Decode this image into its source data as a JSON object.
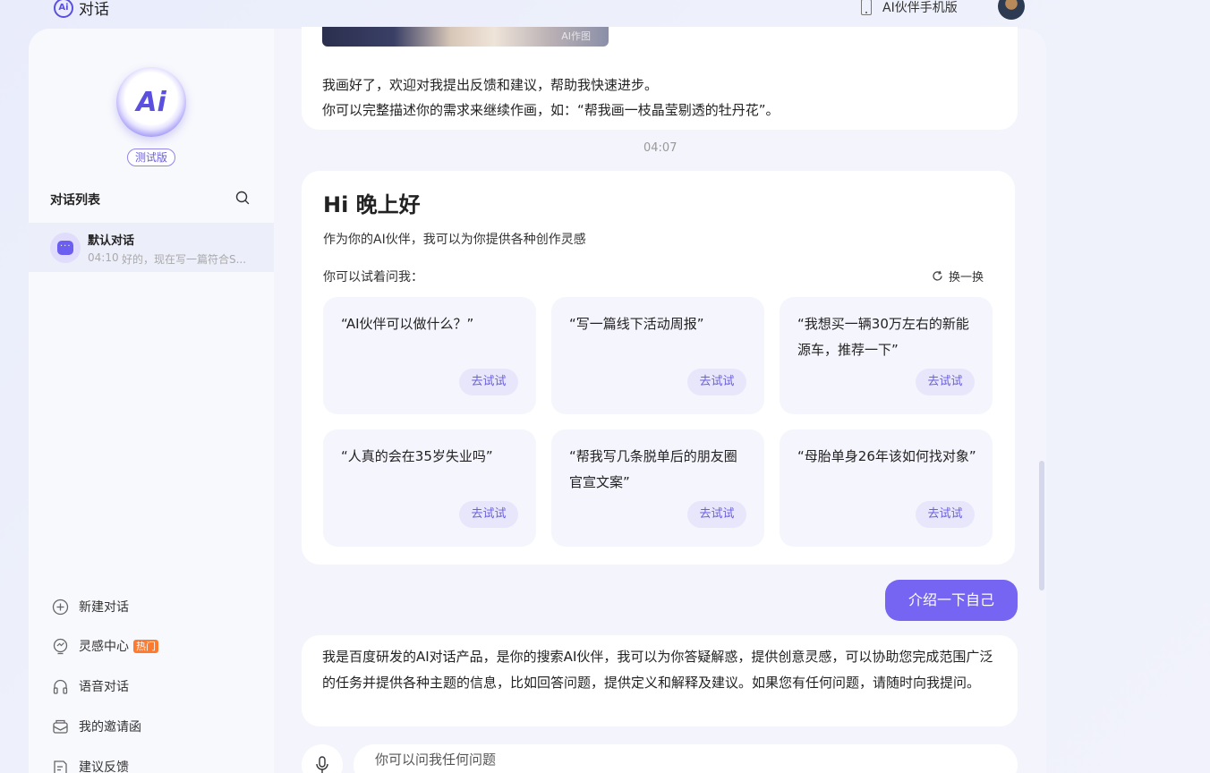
{
  "header": {
    "brand_logo": "Ai",
    "title": "对话",
    "mobile_label": "AI伙伴手机版"
  },
  "sidebar": {
    "logo_text": "Ai",
    "badge": "测试版",
    "list_title": "对话列表",
    "conversations": [
      {
        "title": "默认对话",
        "time": "04:10",
        "preview": "好的，现在写一篇符合S..."
      }
    ],
    "menu": [
      {
        "label": "新建对话",
        "icon": "plus-circle-icon"
      },
      {
        "label": "灵感中心",
        "icon": "bulb-icon",
        "badge": "热门"
      },
      {
        "label": "语音对话",
        "icon": "headphones-icon"
      },
      {
        "label": "我的邀请函",
        "icon": "envelope-icon"
      },
      {
        "label": "建议反馈",
        "icon": "feedback-icon"
      }
    ]
  },
  "chat": {
    "image_tag": "AI作图",
    "prev_line1": "我画好了，欢迎对我提出反馈和建议，帮助我快速进步。",
    "prev_line2": "你可以完整描述你的需求来继续作画，如：“帮我画一枝晶莹剔透的牡丹花”。",
    "timestamp": "04:07",
    "greeting": {
      "title": "Hi 晚上好",
      "subtitle": "作为你的AI伙伴，我可以为你提供各种创作灵感",
      "try_label": "你可以试着问我：",
      "refresh_label": "换一换",
      "suggestions": [
        {
          "text": "“AI伙伴可以做什么？”",
          "button": "去试试"
        },
        {
          "text": "“写一篇线下活动周报”",
          "button": "去试试"
        },
        {
          "text": "“我想买一辆30万左右的新能源车，推荐一下”",
          "button": "去试试"
        },
        {
          "text": "“人真的会在35岁失业吗”",
          "button": "去试试"
        },
        {
          "text": "“帮我写几条脱单后的朋友圈官宣文案”",
          "button": "去试试"
        },
        {
          "text": "“母胎单身26年该如何找对象”",
          "button": "去试试"
        }
      ]
    },
    "user_message": "介绍一下自己",
    "answer": "我是百度研发的AI对话产品，是你的搜索AI伙伴，我可以为你答疑解惑，提供创意灵感，可以协助您完成范围广泛的任务并提供各种主题的信息，比如回答问题，提供定义和解释及建议。如果您有任何问题，请随时向我提问。",
    "input_placeholder": "你可以问我任何问题"
  },
  "colors": {
    "accent": "#7664f2",
    "accent_dark": "#5b4fe0",
    "hot_badge": "#ff7a2c",
    "background": "#eef1fb"
  }
}
